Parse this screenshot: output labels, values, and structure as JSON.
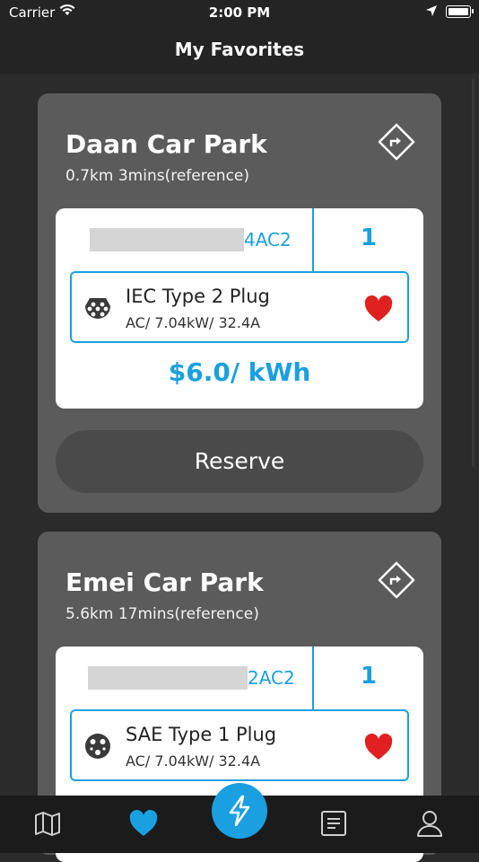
{
  "status": {
    "carrier": "Carrier",
    "time": "2:00 PM"
  },
  "header": {
    "title": "My Favorites"
  },
  "colors": {
    "accent": "#1aa0e0",
    "card": "#5b5b5b",
    "heart": "#e02020"
  },
  "favorites": [
    {
      "name": "Daan Car Park",
      "distance": "0.7km 3mins(reference)",
      "charger_suffix": "4AC2",
      "count": "1",
      "plug": {
        "name": "IEC Type 2 Plug",
        "spec": "AC/ 7.04kW/ 32.4A",
        "icon": "iec-type2-plug-icon"
      },
      "price": "$6.0/ kWh",
      "reserve_label": "Reserve"
    },
    {
      "name": "Emei Car Park",
      "distance": "5.6km 17mins(reference)",
      "charger_suffix": "2AC2",
      "count": "1",
      "plug": {
        "name": "SAE Type 1 Plug",
        "spec": "AC/ 7.04kW/ 32.4A",
        "icon": "sae-type1-plug-icon"
      }
    }
  ],
  "tabs": [
    {
      "icon": "map-icon"
    },
    {
      "icon": "heart-icon",
      "active": true
    },
    {
      "icon": "lightning-icon"
    },
    {
      "icon": "list-icon"
    },
    {
      "icon": "profile-icon"
    }
  ]
}
